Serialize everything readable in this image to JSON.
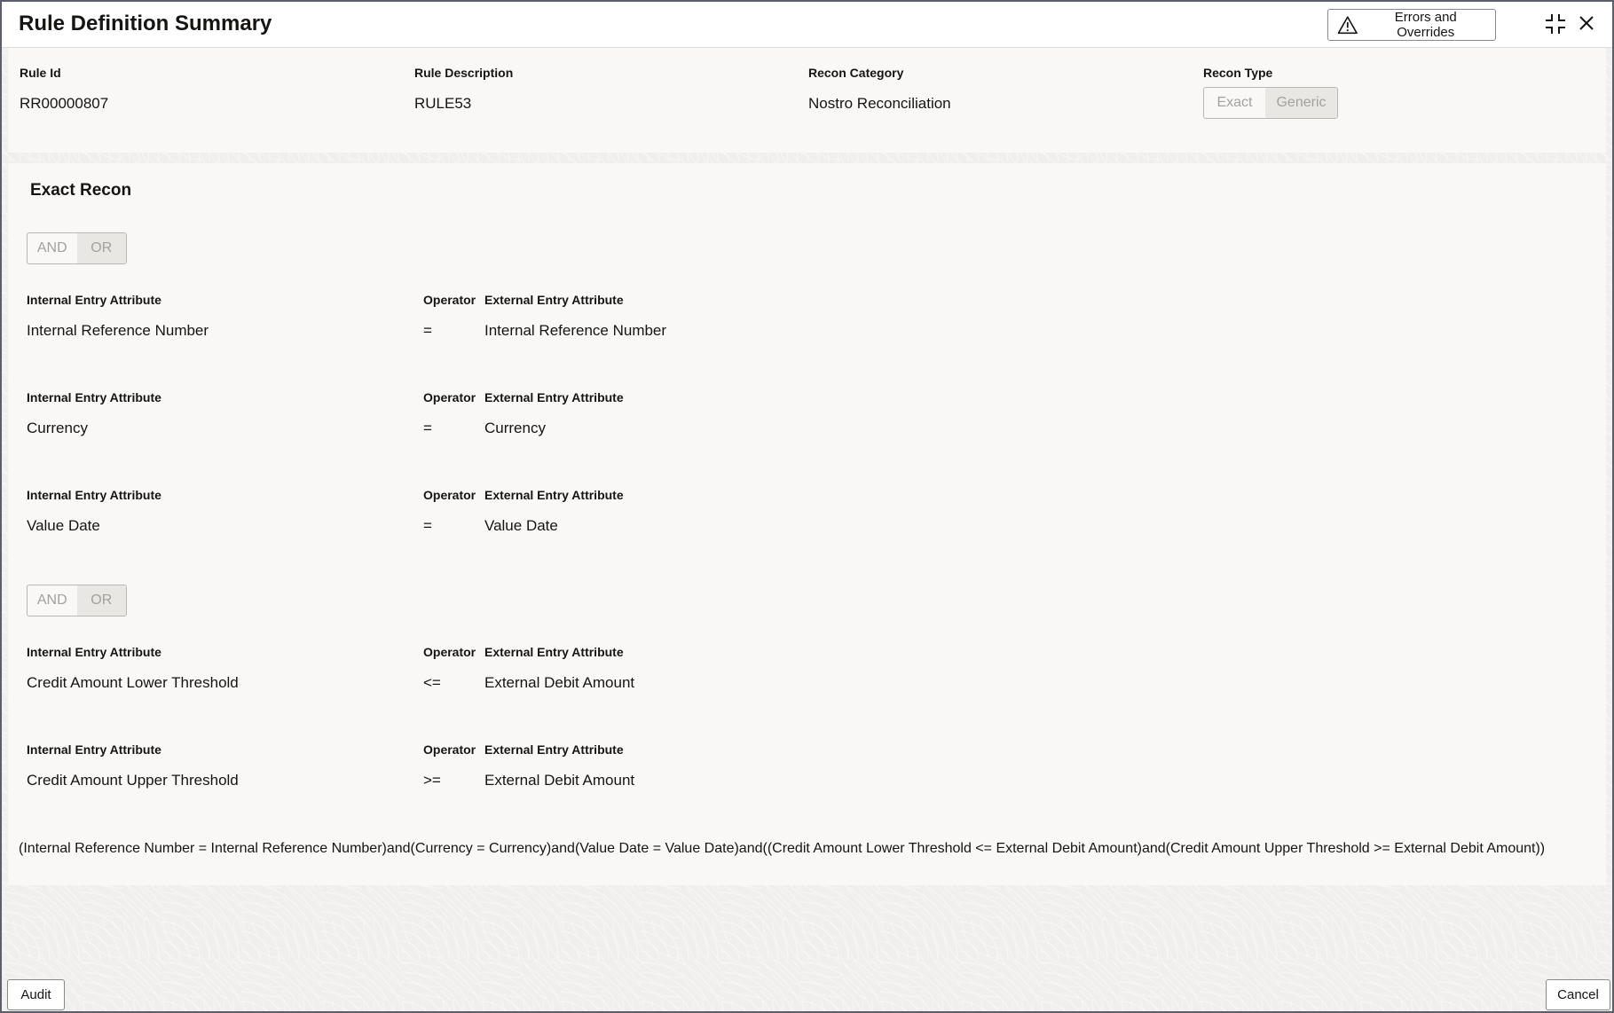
{
  "header": {
    "title": "Rule Definition Summary",
    "errors_label": "Errors and Overrides"
  },
  "summary": {
    "rule_id": {
      "label": "Rule Id",
      "value": "RR00000807"
    },
    "rule_description": {
      "label": "Rule Description",
      "value": "RULE53"
    },
    "recon_category": {
      "label": "Recon Category",
      "value": "Nostro Reconciliation"
    },
    "recon_type": {
      "label": "Recon Type",
      "options": [
        "Exact",
        "Generic"
      ],
      "selected": "Generic"
    }
  },
  "section": {
    "title": "Exact Recon",
    "toggle_options": [
      "AND",
      "OR"
    ],
    "toggle_selected": "OR",
    "labels": {
      "internal": "Internal Entry Attribute",
      "operator": "Operator",
      "external": "External Entry Attribute"
    },
    "group1": [
      {
        "internal": "Internal Reference Number",
        "operator": "=",
        "external": "Internal Reference Number"
      },
      {
        "internal": "Currency",
        "operator": "=",
        "external": "Currency"
      },
      {
        "internal": "Value Date",
        "operator": "=",
        "external": "Value Date"
      }
    ],
    "group2": [
      {
        "internal": "Credit Amount Lower Threshold",
        "operator": "<=",
        "external": "External Debit Amount"
      },
      {
        "internal": "Credit Amount Upper Threshold",
        "operator": ">=",
        "external": "External Debit Amount"
      }
    ],
    "expression": "(Internal Reference Number = Internal Reference Number)and(Currency = Currency)and(Value Date = Value Date)and((Credit Amount Lower Threshold <= External Debit Amount)and(Credit Amount Upper Threshold >= External Debit Amount))"
  },
  "footer": {
    "audit_label": "Audit",
    "cancel_label": "Cancel"
  },
  "icons": {
    "warning": "warning-triangle-icon",
    "collapse": "collapse-icon",
    "close": "close-icon"
  }
}
